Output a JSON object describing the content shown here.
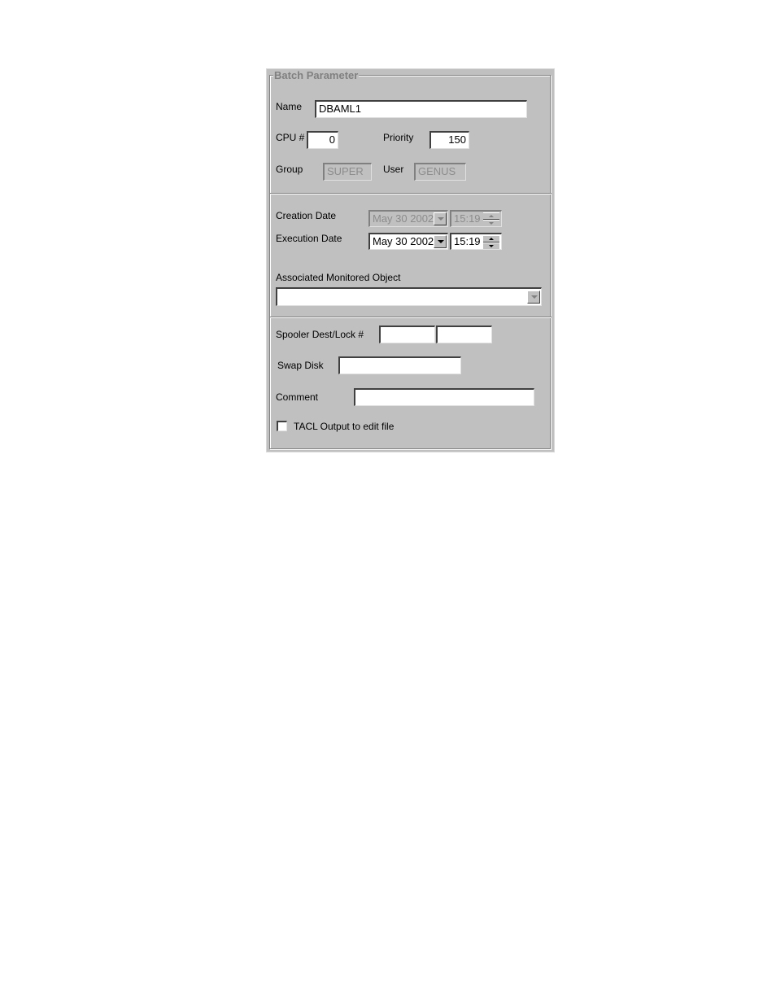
{
  "group": {
    "title": "Batch Parameter"
  },
  "fields": {
    "name": {
      "label": "Name",
      "value": "DBAML1"
    },
    "cpu": {
      "label": "CPU #",
      "value": "0"
    },
    "priority": {
      "label": "Priority",
      "value": "150"
    },
    "group": {
      "label": "Group",
      "value": "SUPER"
    },
    "user": {
      "label": "User",
      "value": "GENUS"
    },
    "creation_date": {
      "label": "Creation Date",
      "date": "May 30 2002",
      "time": "15:19",
      "enabled": false
    },
    "execution_date": {
      "label": "Execution Date",
      "date": "May 30 2002",
      "time": "15:19",
      "enabled": true
    },
    "monitored_object": {
      "label": "Associated Monitored Object",
      "value": ""
    },
    "spooler": {
      "label": "Spooler Dest/Lock #",
      "dest": "",
      "lock": ""
    },
    "swap_disk": {
      "label": "Swap Disk",
      "value": ""
    },
    "comment": {
      "label": "Comment",
      "value": ""
    },
    "tacl_output": {
      "label": "TACL Output to edit file",
      "checked": false
    }
  }
}
